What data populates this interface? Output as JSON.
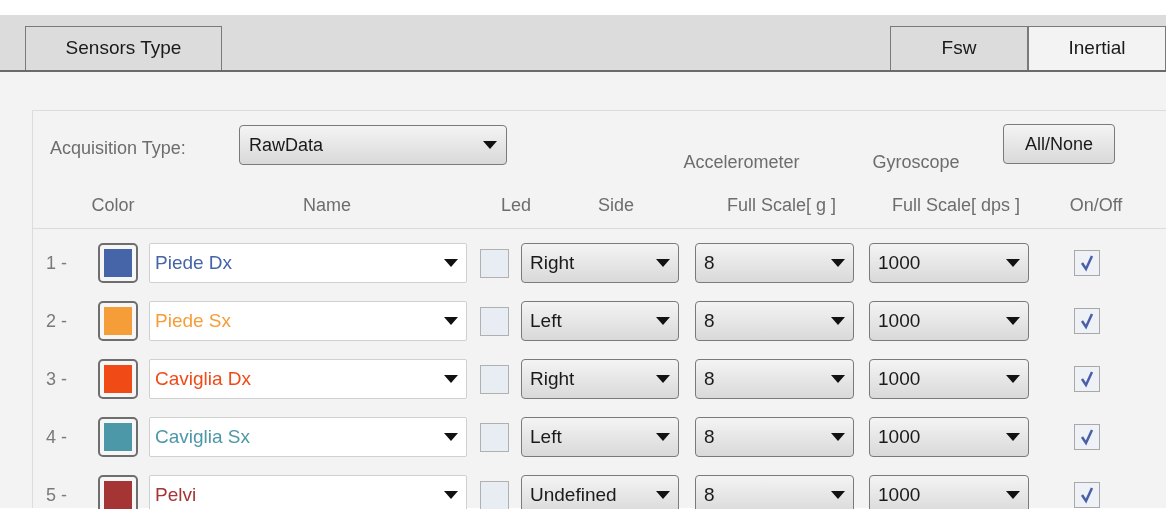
{
  "tabs_left": [
    {
      "label": "Sensors Type",
      "selected": false
    }
  ],
  "tabs_right": [
    {
      "label": "Fsw",
      "selected": false
    },
    {
      "label": "Inertial",
      "selected": true
    }
  ],
  "acquisition": {
    "label": "Acquisition Type:",
    "value": "RawData"
  },
  "all_none_button": "All/None",
  "column_headers": {
    "color_label": "Color",
    "name": "Name",
    "led": "Led",
    "side": "Side",
    "accel_top": "Accelerometer",
    "accel": "Full Scale[ g ]",
    "gyro_top": "Gyroscope",
    "gyro": "Full Scale[ dps ]",
    "on_off": "On/Off"
  },
  "sensors": [
    {
      "index": "1 -",
      "color": "#4565a8",
      "name": "Piede Dx",
      "led": false,
      "side": "Right",
      "accel": "8",
      "gyro": "1000",
      "on": true
    },
    {
      "index": "2 -",
      "color": "#f59d38",
      "name": "Piede Sx",
      "led": false,
      "side": "Left",
      "accel": "8",
      "gyro": "1000",
      "on": true
    },
    {
      "index": "3 -",
      "color": "#f04a16",
      "name": "Caviglia Dx",
      "led": false,
      "side": "Right",
      "accel": "8",
      "gyro": "1000",
      "on": true
    },
    {
      "index": "4 -",
      "color": "#4d98a8",
      "name": "Caviglia Sx",
      "led": false,
      "side": "Left",
      "accel": "8",
      "gyro": "1000",
      "on": true
    },
    {
      "index": "5 -",
      "color": "#a53535",
      "name": "Pelvi",
      "led": false,
      "side": "Undefined",
      "accel": "8",
      "gyro": "1000",
      "on": true
    }
  ]
}
